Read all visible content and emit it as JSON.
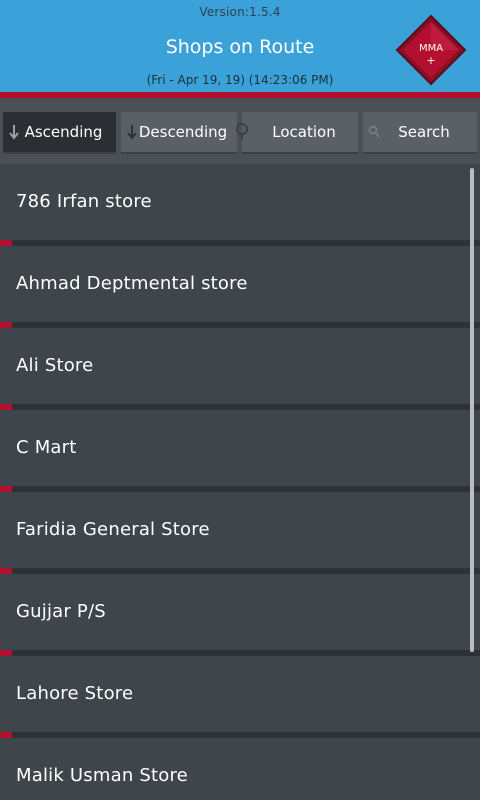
{
  "header": {
    "version": "Version:1.5.4",
    "title": "Shops on Route",
    "datetime": "(Fri - Apr 19, 19) (14:23:06 PM)",
    "logo_text": "MMA",
    "logo_plus": "+"
  },
  "tabs": [
    {
      "label": "Ascending",
      "icon": "arrow-down-icon",
      "active": true
    },
    {
      "label": "Descending",
      "icon": "arrow-down-icon",
      "active": false
    },
    {
      "label": "Location",
      "icon": "location-pin-icon",
      "active": false
    },
    {
      "label": "Search",
      "icon": "search-icon",
      "active": false
    }
  ],
  "shops": [
    "786 Irfan store",
    "Ahmad Deptmental store",
    "Ali Store",
    "C Mart",
    "Faridia General Store",
    "Gujjar P/S",
    "Lahore Store",
    "Malik Usman Store"
  ],
  "colors": {
    "header_bg": "#3aa2d9",
    "accent_red": "#b3102f",
    "row_bg": "#3f464b",
    "tab_active_bg": "#2b2f33",
    "tab_bg": "#5a6065"
  }
}
